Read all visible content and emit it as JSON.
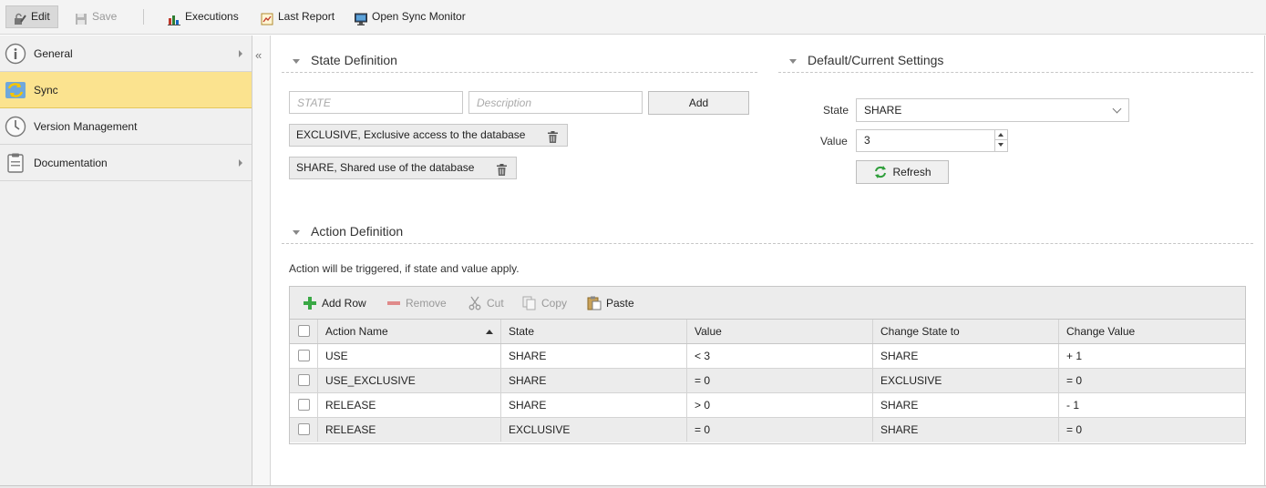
{
  "toolbar": {
    "edit_label": "Edit",
    "save_label": "Save",
    "executions_label": "Executions",
    "last_report_label": "Last Report",
    "open_sync_monitor_label": "Open Sync Monitor"
  },
  "sidebar": {
    "items": [
      {
        "label": "General",
        "icon": "info-icon",
        "has_arrow": true
      },
      {
        "label": "Sync",
        "icon": "sync-icon",
        "selected": true
      },
      {
        "label": "Version Management",
        "icon": "clock-icon"
      },
      {
        "label": "Documentation",
        "icon": "clipboard-icon",
        "has_arrow": true
      }
    ],
    "collapse_glyph": "«"
  },
  "state_definition": {
    "title": "State Definition",
    "state_placeholder": "STATE",
    "description_placeholder": "Description",
    "add_label": "Add",
    "states": [
      "EXCLUSIVE, Exclusive access to the database",
      "SHARE, Shared use of the database"
    ]
  },
  "default_settings": {
    "title": "Default/Current Settings",
    "state_label": "State",
    "state_value": "SHARE",
    "value_label": "Value",
    "value_value": "3",
    "refresh_label": "Refresh"
  },
  "action_definition": {
    "title": "Action Definition",
    "hint": "Action will be triggered, if state and value apply.",
    "toolbar": {
      "add_row": "Add Row",
      "remove": "Remove",
      "cut": "Cut",
      "copy": "Copy",
      "paste": "Paste"
    },
    "columns": [
      "Action Name",
      "State",
      "Value",
      "Change State to",
      "Change Value"
    ],
    "rows": [
      [
        "USE",
        "SHARE",
        "< 3",
        "SHARE",
        "+ 1"
      ],
      [
        "USE_EXCLUSIVE",
        "SHARE",
        "= 0",
        "EXCLUSIVE",
        "= 0"
      ],
      [
        "RELEASE",
        "SHARE",
        "> 0",
        "SHARE",
        "- 1"
      ],
      [
        "RELEASE",
        "EXCLUSIVE",
        "= 0",
        "SHARE",
        "= 0"
      ]
    ]
  },
  "colors": {
    "selected_nav": "#fbe38f",
    "toolbar_bg": "#f3f3f3",
    "grid_alt_row": "#ececec"
  }
}
